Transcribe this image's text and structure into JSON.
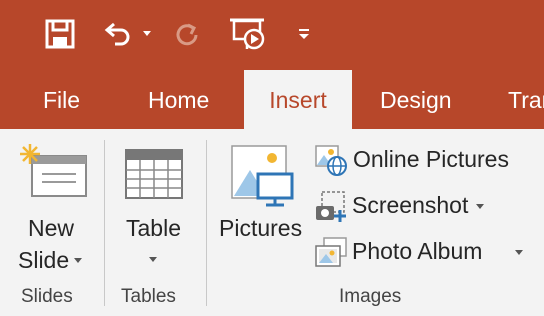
{
  "quick_access": {
    "items": [
      {
        "name": "save-icon"
      },
      {
        "name": "undo-icon"
      },
      {
        "name": "redo-icon"
      },
      {
        "name": "present-from-start-icon"
      },
      {
        "name": "customize-qat-icon"
      }
    ]
  },
  "tabs": [
    {
      "label": "File"
    },
    {
      "label": "Home"
    },
    {
      "label": "Insert",
      "active": true
    },
    {
      "label": "Design"
    },
    {
      "label": "Tran"
    }
  ],
  "ribbon": {
    "slides": {
      "new_slide_line1": "New",
      "new_slide_line2": "Slide",
      "group_label": "Slides"
    },
    "tables": {
      "table_label": "Table",
      "group_label": "Tables"
    },
    "images": {
      "pictures_label": "Pictures",
      "online_pictures_label": "Online Pictures",
      "screenshot_label": "Screenshot",
      "photo_album_label": "Photo Album",
      "group_label": "Images"
    }
  },
  "colors": {
    "accent": "#b7472a",
    "ribbon_bg": "#f3f3f3",
    "icon_blue": "#2e75b6"
  }
}
